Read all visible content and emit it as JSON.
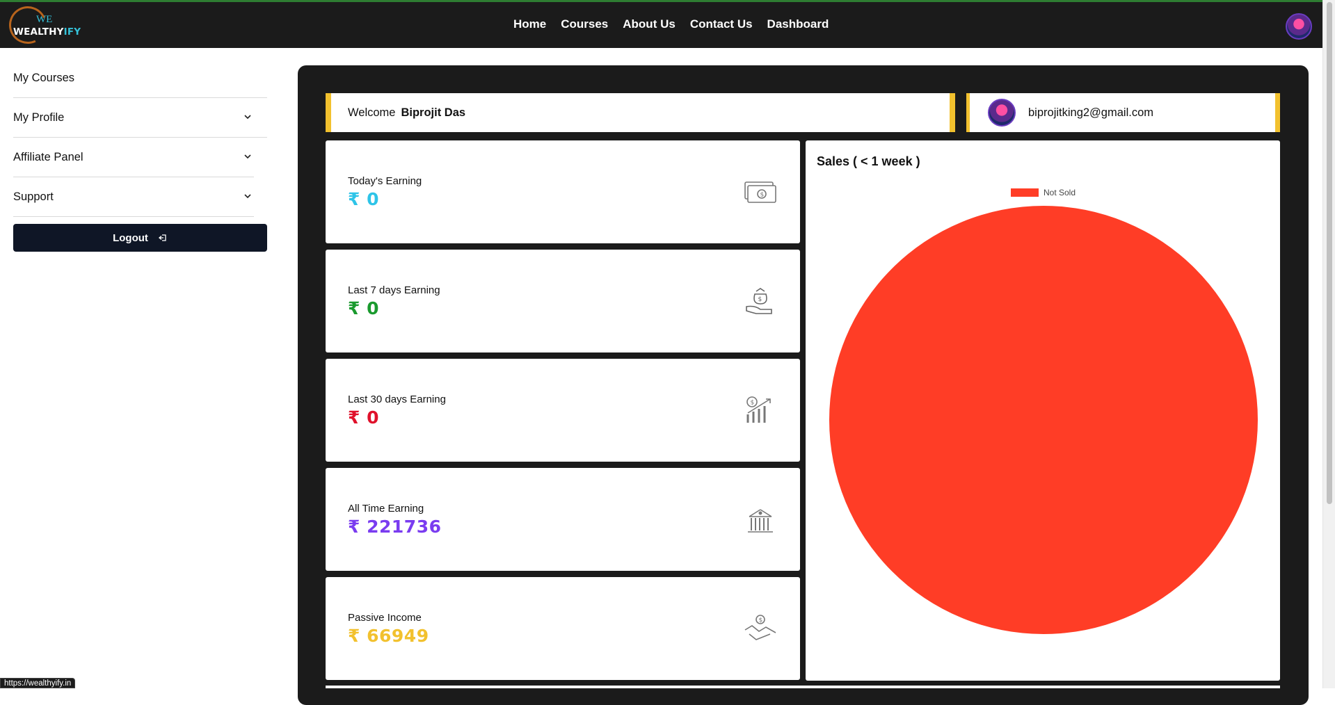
{
  "header": {
    "logo": {
      "we": "WE",
      "brand_main": "WEALTHY",
      "brand_accent": "IFY"
    },
    "nav": [
      "Home",
      "Courses",
      "About Us",
      "Contact Us",
      "Dashboard"
    ]
  },
  "sidebar": {
    "items": [
      {
        "label": "My Courses",
        "has_chevron": false
      },
      {
        "label": "My Profile",
        "has_chevron": true
      },
      {
        "label": "Affiliate Panel",
        "has_chevron": true
      },
      {
        "label": "Support",
        "has_chevron": true
      }
    ],
    "logout_label": "Logout"
  },
  "welcome": {
    "prefix": "Welcome",
    "name": "Biprojit Das"
  },
  "user": {
    "email": "biprojitking2@gmail.com"
  },
  "cards": [
    {
      "title": "Today's Earning",
      "currency": "₹",
      "value": "0",
      "color": "#2ec4e8",
      "icon": "cash-stack-icon"
    },
    {
      "title": "Last 7 days Earning",
      "currency": "₹",
      "value": "0",
      "color": "#1a9a2e",
      "icon": "money-bag-hand-icon"
    },
    {
      "title": "Last 30 days Earning",
      "currency": "₹",
      "value": "0",
      "color": "#e0112b",
      "icon": "growth-chart-icon"
    },
    {
      "title": "All Time Earning",
      "currency": "₹",
      "value": "221736",
      "color": "#7a3cf0",
      "icon": "bank-building-icon"
    },
    {
      "title": "Passive Income",
      "currency": "₹",
      "value": "66949",
      "color": "#f2c12e",
      "icon": "handshake-dollar-icon"
    }
  ],
  "chart_data": {
    "type": "pie",
    "title": "Sales ( < 1 week )",
    "legend_position": "top-center",
    "categories": [
      "Not Sold"
    ],
    "values": [
      1
    ],
    "colors": [
      "#ff3d26"
    ]
  },
  "status_bar": {
    "url": "https://wealthyify.in"
  },
  "colors": {
    "accent_yellow": "#f2c12e",
    "panel_dark": "#1b1b1b",
    "button_dark": "#0f1626"
  }
}
